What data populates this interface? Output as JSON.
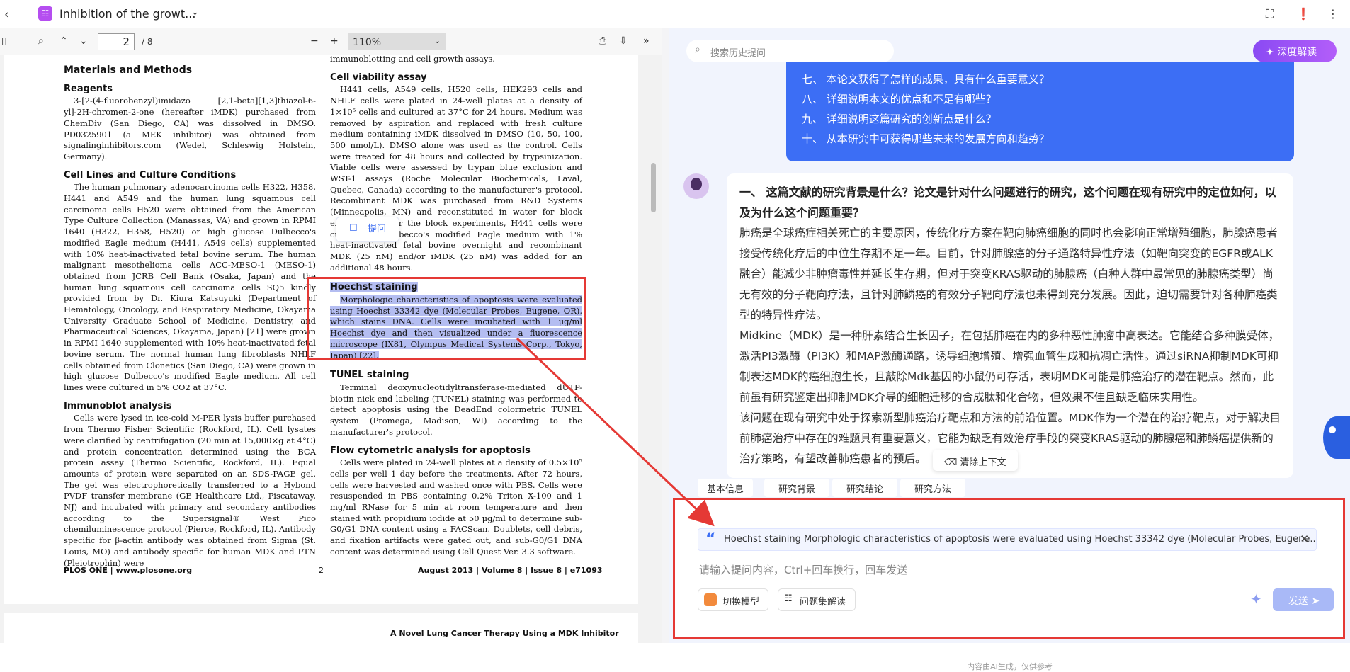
{
  "topbar": {
    "title": "Inhibition of the growt...",
    "icon_names": [
      "back-icon",
      "document-icon",
      "chevron-down-icon",
      "fullscreen-icon",
      "feedback-icon",
      "more-icon"
    ]
  },
  "pdf_toolbar": {
    "page_current": "2",
    "page_total": "/ 8",
    "zoom": "110%"
  },
  "pdf": {
    "left_col": {
      "h_methods": "Materials and Methods",
      "h_reagents": "Reagents",
      "p_reagents": "3-[2-(4-fluorobenzyl)imidazo [2,1-beta][1,3]thiazol-6-yl]-2H-chromen-2-one (hereafter iMDK) purchased from ChemDiv (San Diego, CA) was dissolved in DMSO. PD0325901 (a MEK inhibitor) was obtained from signalinginhibitors.com (Wedel, Schleswig Holstein, Germany).",
      "h_cell": "Cell Lines and Culture Conditions",
      "p_cell": "The human pulmonary adenocarcinoma cells H322, H358, H441 and A549 and the human lung squamous cell carcinoma cells H520 were obtained from the American Type Culture Collection (Manassas, VA) and grown in RPMI 1640 (H322, H358, H520) or high glucose Dulbecco's modified Eagle medium (H441, A549 cells) supplemented with 10% heat-inactivated fetal bovine serum. The human malignant mesothelioma cells ACC-MESO-1 (MESO-1) obtained from JCRB Cell Bank (Osaka, Japan) and the human lung squamous cell carcinoma cells SQ5 kindly provided from by Dr. Kiura Katsuyuki (Department of Hematology, Oncology, and Respiratory Medicine, Okayama University Graduate School of Medicine, Dentistry, and Pharmaceutical Sciences, Okayama, Japan) [21] were grown in RPMI 1640 supplemented with 10% heat-inactivated fetal bovine serum. The normal human lung fibroblasts NHLF cells obtained from Clonetics (San Diego, CA) were grown in high glucose Dulbecco's modified Eagle medium. All cell lines were cultured in 5% CO2 at 37°C.",
      "h_immuno": "Immunoblot analysis",
      "p_immuno": "Cells were lysed in ice-cold M-PER lysis buffer purchased from Thermo Fisher Scientific (Rockford, IL). Cell lysates were clarified by centrifugation (20 min at 15,000×g at 4°C) and protein concentration determined using the BCA protein assay (Thermo Scientific, Rockford, IL). Equal amounts of protein were separated on an SDS-PAGE gel. The gel was electrophoretically transferred to a Hybond PVDF transfer membrane (GE Healthcare Ltd., Piscataway, NJ) and incubated with primary and secondary antibodies according to the Supersignal® West Pico chemiluminescence protocol (Pierce, Rockford, IL). Antibody specific for β-actin antibody was obtained from Sigma (St. Louis, MO) and antibody specific for human MDK and PTN (Pleiotrophin) were"
    },
    "right_col": {
      "top_line": "immunoblotting and cell growth assays.",
      "h_viab": "Cell viability assay",
      "p_viab": "H441 cells, A549 cells, H520 cells, HEK293 cells and NHLF cells were plated in 24-well plates at a density of 1×10⁵ cells and cultured at 37°C for 24 hours. Medium was removed by aspiration and replaced with fresh culture medium containing iMDK dissolved in DMSO (10, 50, 100, 500 nmol/L). DMSO alone was used as the control. Cells were treated for 48 hours and collected by trypsinization. Viable cells were assessed by trypan blue exclusion and WST-1 assays (Roche Molecular Biochemicals, Laval, Quebec, Canada) according to the manufacturer's protocol. Recombinant MDK was purchased from R&D Systems (Minneapolis, MN) and reconstituted in water for block experiments. For the block experiments, H441 cells were cultured in Dulbecco's modified Eagle medium with 1% heat-inactivated fetal bovine overnight and recombinant MDK (25 nM) and/or iMDK (25 nM) was added for an additional 48 hours.",
      "h_hoechst": "Hoechst staining",
      "p_hoechst": "Morphologic characteristics of apoptosis were evaluated using Hoechst 33342 dye (Molecular Probes, Eugene, OR), which stains DNA. Cells were incubated with 1 μg/ml Hoechst dye and then visualized under a fluorescence microscope (IX81, Olympus Medical Systems Corp., Tokyo, Japan) [22].",
      "h_tunel": "TUNEL staining",
      "p_tunel": "Terminal deoxynucleotidyltransferase-mediated dUTP-biotin nick end labeling (TUNEL) staining was performed to detect apoptosis using the DeadEnd colormetric TUNEL system (Promega, Madison, WI) according to the manufacturer's protocol.",
      "h_flow": "Flow cytometric analysis for apoptosis",
      "p_flow": "Cells were plated in 24-well plates at a density of 0.5×10⁵ cells per well 1 day before the treatments. After 72 hours, cells were harvested and washed once with PBS. Cells were resuspended in PBS containing 0.2% Triton X-100 and 1 mg/ml RNase for 5 min at room temperature and then stained with propidium iodide at 50 μg/ml to determine sub-G0/G1 DNA content using a FACScan. Doublets, cell debris, and fixation artifacts were gated out, and sub-G0/G1 DNA content was determined using Cell Quest Ver. 3.3 software."
    },
    "ask_button": "提问",
    "footer_left": "PLOS ONE | www.plosone.org",
    "footer_page": "2",
    "footer_right": "August 2013 | Volume 8 | Issue 8 | e71093",
    "next_page_header": "A Novel Lung Cancer Therapy Using a MDK Inhibitor"
  },
  "ai": {
    "search_placeholder": "搜索历史提问",
    "deep_button": "深度解读",
    "questions": [
      "七、 本论文获得了怎样的成果，具有什么重要意义？",
      "八、 详细说明本文的优点和不足有哪些？",
      "九、 详细说明这篇研究的创新点是什么？",
      "十、 从本研究中可获得哪些未来的发展方向和趋势？"
    ],
    "answer_q": "一、 这篇文献的研究背景是什么？论文是针对什么问题进行的研究，这个问题在现有研究中的定位如何，以及为什么这个问题重要？",
    "answer_p1": "肺癌是全球癌症相关死亡的主要原因，传统化疗方案在靶向肺癌细胞的同时也会影响正常增殖细胞，肺腺癌患者接受传统化疗后的中位生存期不足一年。目前，针对肺腺癌的分子通路特异性疗法（如靶向突变的EGFR或ALK融合）能减少非肿瘤毒性并延长生存期，但对于突变KRAS驱动的肺腺癌（白种人群中最常见的肺腺癌类型）尚无有效的分子靶向疗法，且针对肺鳞癌的有效分子靶向疗法也未得到充分发展。因此，迫切需要针对各种肺癌类型的特异性疗法。",
    "answer_p2": "Midkine（MDK）是一种肝素结合生长因子，在包括肺癌在内的多种恶性肿瘤中高表达。它能结合多种膜受体，激活PI3激酶（PI3K）和MAP激酶通路，诱导细胞增殖、增强血管生成和抗凋亡活性。通过siRNA抑制MDK可抑制表达MDK的癌细胞生长，且敲除Mdk基因的小鼠仍可存活，表明MDK可能是肺癌治疗的潜在靶点。然而，此前虽有研究鉴定出抑制MDK介导的细胞迁移的合成肽和化合物，但效果不佳且缺乏临床实用性。",
    "answer_p3": "该问题在现有研究中处于探索新型肺癌治疗靶点和方法的前沿位置。MDK作为一个潜在的治疗靶点，对于解决目前肺癌治疗中存在的难题具有重要意义，它能为缺乏有效治疗手段的突变KRAS驱动的肺腺癌和肺鳞癌提供新的治疗策略，有望改善肺癌患者的预后。",
    "clear_context": "清除上下文",
    "chips": [
      "基本信息",
      "研究背景",
      "研究结论",
      "研究方法"
    ],
    "quote_text": "Hoechst staining Morphologic characteristics of apoptosis were evaluated using Hoechst 33342 dye (Molecular Probes, Eugene...",
    "input_placeholder": "请输入提问内容，Ctrl+回车换行，回车发送",
    "switch_model": "切换模型",
    "question_set": "问题集解读",
    "send": "发送",
    "disclaimer": "内容由AI生成，仅供参考"
  },
  "colors": {
    "accent_blue": "#3c6ef5",
    "highlight": "#b4bdf1",
    "annotation_red": "#e53935",
    "deep_purple": "#8a4af3"
  }
}
